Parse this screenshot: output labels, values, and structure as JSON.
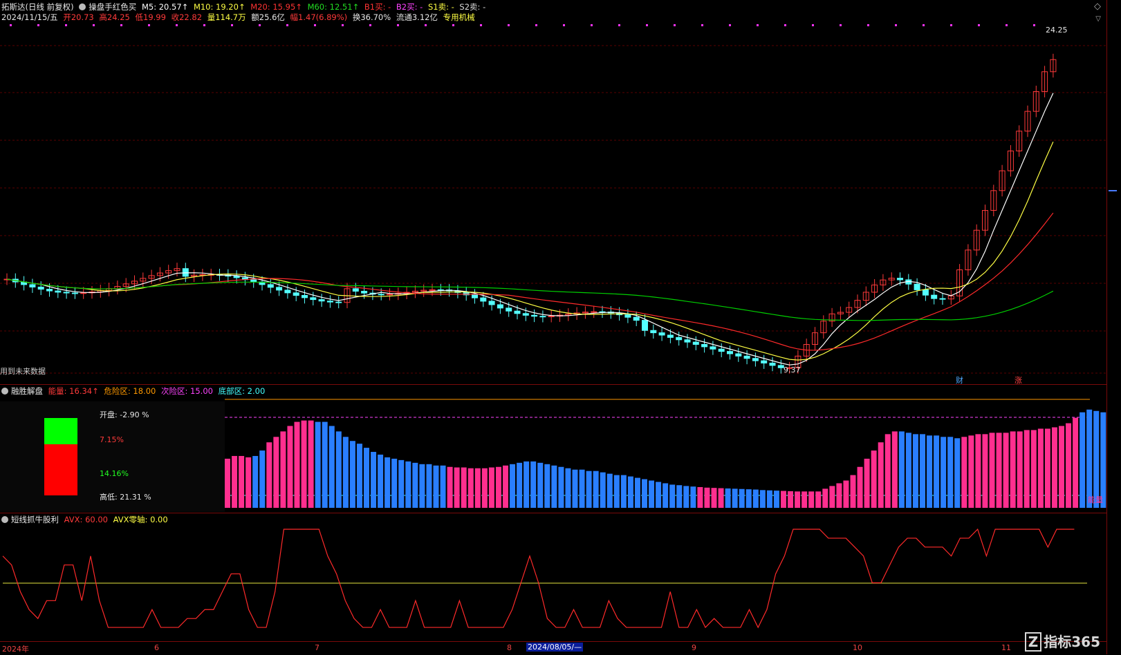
{
  "header": {
    "stock": "拓斯达(日线 前复权)",
    "ind_name": "操盘手红色买",
    "m5": "M5: 20.57↑",
    "m10": "M10: 19.20↑",
    "m20": "M20: 15.95↑",
    "m60": "M60: 12.51↑",
    "b1": "B1买: -",
    "b2": "B2买: -",
    "s1": "S1卖: -",
    "s2": "S2卖: -",
    "date": "2024/11/15/五",
    "open": "开20.73",
    "high": "高24.25",
    "low": "低19.99",
    "close": "收22.82",
    "vol": "量114.7万",
    "amt": "额25.6亿",
    "chg": "幅1.47(6.89%)",
    "turn": "换36.70%",
    "float": "流通3.12亿",
    "industry": "专用机械"
  },
  "labels": {
    "future": "用到未来数据",
    "high_mark": "24.25",
    "low_mark": "9.37",
    "cai": "财",
    "zhang": "涨"
  },
  "ind1": {
    "name": "融胜解盘",
    "nengliang": "能量: 16.34↑",
    "danger": "危险区: 18.00",
    "sub_danger": "次险区: 15.00",
    "bottom": "底部区: 2.00",
    "open_label": "开盘: -2.90 %",
    "v1": "7.15%",
    "v2": "14.16%",
    "hl": "高低: 21.31 %",
    "energy_tag": "能量"
  },
  "ind2": {
    "name": "短线抓牛股利",
    "avx": "AVX: 60.00",
    "avx_zero": "AVX零轴: 0.00"
  },
  "time_axis": {
    "t0": "2024年",
    "t1": "6",
    "t2": "7",
    "t3": "8",
    "cursor": "2024/08/05/—",
    "t4": "9",
    "t5": "10",
    "t6": "11"
  },
  "watermark": "指标365",
  "colors": {
    "up": "#ff3a3a",
    "down": "#54ffff",
    "m5": "#ffffff",
    "m10": "#ffff44",
    "m20": "#ff2a2a",
    "m60": "#00d000",
    "pink": "#ff2f8f",
    "blue": "#2a7fff"
  },
  "chart_data": {
    "type": "candlestick",
    "title": "拓斯达(日线 前复权)",
    "date": "2024/11/15",
    "ohlc_last": {
      "open": 20.73,
      "high": 24.25,
      "low": 19.99,
      "close": 22.82
    },
    "period_high": 24.25,
    "period_low": 9.37,
    "ma": {
      "M5": 20.57,
      "M10": 19.2,
      "M20": 15.95,
      "M60": 12.51
    },
    "ind1_series": [
      18,
      19,
      19,
      18.5,
      19,
      21,
      24,
      26,
      28,
      30,
      31.5,
      32,
      32,
      31.5,
      31.5,
      30,
      28,
      26,
      24.5,
      23.5,
      22,
      20.5,
      19.5,
      18.5,
      18,
      17.5,
      17,
      16.5,
      16,
      16,
      15.5,
      15.5,
      15,
      14.8,
      14.8,
      14.5,
      14.5,
      14.5,
      14.8,
      15,
      15.5,
      16,
      16.5,
      17,
      17,
      16.5,
      16,
      15.5,
      15,
      14.5,
      14,
      14,
      13.5,
      13.5,
      13,
      12.5,
      12,
      12,
      11.5,
      11,
      10.5,
      10,
      9.5,
      9,
      8.5,
      8.3,
      8,
      7.8,
      7.6,
      7.4,
      7.3,
      7.2,
      7.1,
      7,
      6.9,
      6.8,
      6.7,
      6.5,
      6.4,
      6.3,
      6.2,
      6.1,
      6,
      6,
      6,
      6,
      7,
      8,
      9,
      10,
      12,
      15,
      18,
      21,
      24,
      27,
      28,
      28,
      27.5,
      27,
      27,
      26.5,
      26.5,
      26,
      26,
      25.5,
      26,
      26.5,
      27,
      27,
      27.5,
      27.5,
      27.5,
      28,
      28,
      28.5,
      28.5,
      29,
      29,
      29.5,
      30,
      31,
      33,
      35,
      36,
      35.5,
      35,
      35,
      35,
      35.5,
      36,
      37,
      37.5
    ],
    "ind1_colors": "ppppbbpppppppbbbbbbbbbbbbbbbbbbbpppppppppbbbbbbbbbbbbbbbbbbbbbbbbbbbppppbbbbbbbbpppppppppppppppppbbbbbbbbbpppppppppppppppppbbbbbbpppp",
    "ind2_series": [
      45,
      40,
      25,
      15,
      10,
      20,
      20,
      40,
      40,
      20,
      45,
      20,
      5,
      5,
      5,
      5,
      5,
      15,
      5,
      5,
      5,
      10,
      10,
      15,
      15,
      25,
      35,
      35,
      15,
      5,
      5,
      25,
      60,
      60,
      60,
      60,
      60,
      45,
      35,
      20,
      10,
      5,
      5,
      15,
      5,
      5,
      5,
      20,
      5,
      5,
      5,
      5,
      20,
      5,
      5,
      5,
      5,
      5,
      15,
      30,
      45,
      30,
      10,
      5,
      5,
      15,
      5,
      5,
      5,
      20,
      10,
      5,
      5,
      5,
      5,
      5,
      25,
      5,
      5,
      15,
      5,
      10,
      5,
      5,
      5,
      15,
      5,
      15,
      35,
      45,
      60,
      60,
      60,
      60,
      55,
      55,
      55,
      50,
      45,
      30,
      30,
      40,
      50,
      55,
      55,
      50,
      50,
      50,
      45,
      55,
      55,
      60,
      45,
      60,
      60,
      60,
      60,
      60,
      60,
      50,
      60,
      60,
      60
    ],
    "avx": 60.0,
    "avx_zero": 0.0
  }
}
